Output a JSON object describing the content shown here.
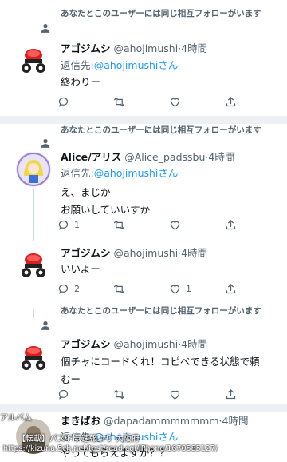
{
  "context_text": "あなたとこのユーザーには同じ相互フォローがいます",
  "reply_prefix": "返信先:",
  "reply_suffix": "さん",
  "tweets": [
    {
      "name": "アゴジムシ",
      "handle": "@ahojimushi",
      "time": "·4時間",
      "reply_to": "@ahojimushi",
      "lines": [
        "終わりー"
      ],
      "reply_count": "",
      "retweet_count": "",
      "like_count": ""
    },
    {
      "name": "Alice/アリス",
      "handle": "@Alice_padssbu",
      "time": "·4時間",
      "reply_to": "@ahojimushi",
      "lines": [
        "え、まじか",
        "お願いしていいすか"
      ],
      "reply_count": "1",
      "retweet_count": "",
      "like_count": ""
    },
    {
      "name": "アゴジムシ",
      "handle": "@ahojimushi",
      "time": "·4時間",
      "lines": [
        "いいよー"
      ],
      "reply_count": "2",
      "retweet_count": "",
      "like_count": "1"
    },
    {
      "name": "アゴジムシ",
      "handle": "@ahojimushi",
      "time": "·4時間",
      "lines": [
        "個チャにコードくれ！コピペできる状態で頼",
        "むー"
      ],
      "reply_count": "",
      "retweet_count": "",
      "like_count": ""
    },
    {
      "name": "まきばお",
      "handle": "@dapadammmmmmm",
      "time": "·4時間",
      "reply_to": "@ahojimushi",
      "lines": [
        "やってもらえますか？？"
      ]
    }
  ],
  "overlay": {
    "line1": "アルバム",
    "line2": "【転載】パズドラ速報より 大阪府",
    "line3": "https://kizuna.5ch.net/test/read.cgi/iPhone/1670585127/"
  },
  "colors": {
    "accent": "#1d9bf0",
    "muted": "#536471",
    "separator": "#eef1f3",
    "text": "#0f1419"
  },
  "icons": [
    "person-icon",
    "reply-icon",
    "retweet-icon",
    "like-icon",
    "share-icon"
  ]
}
